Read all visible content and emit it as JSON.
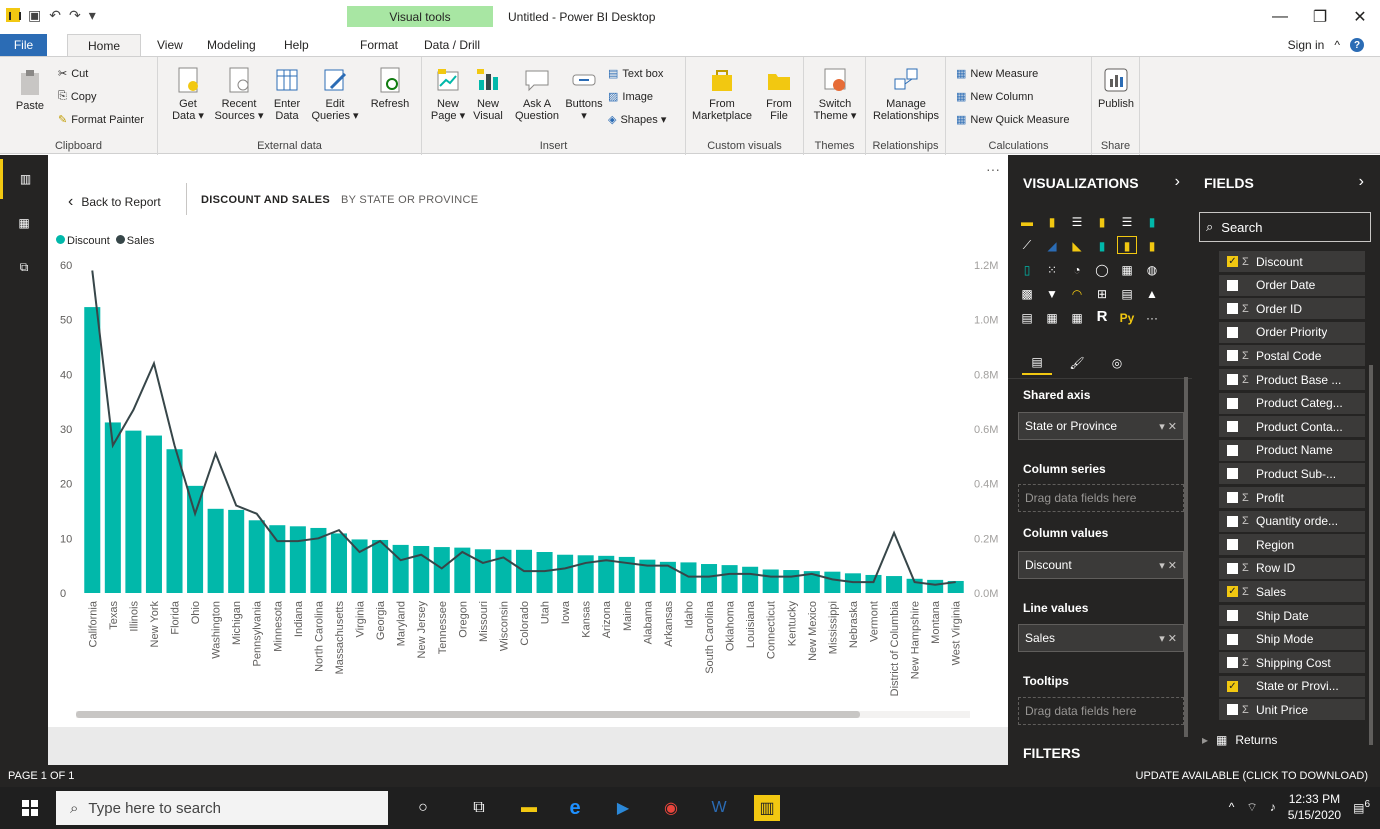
{
  "window": {
    "title": "Untitled - Power BI Desktop",
    "context_tab": "Visual tools",
    "controls": [
      "—",
      "❐",
      "✕"
    ]
  },
  "menu": {
    "file": "File",
    "tabs": [
      "Home",
      "View",
      "Modeling",
      "Help",
      "Format",
      "Data / Drill"
    ],
    "sign_in": "Sign in"
  },
  "ribbon": {
    "clipboard": {
      "label": "Clipboard",
      "paste": "Paste",
      "cut": "Cut",
      "copy": "Copy",
      "format_painter": "Format Painter"
    },
    "external_data": {
      "label": "External data",
      "get_data": "Get Data ▾",
      "recent_sources": "Recent Sources ▾",
      "enter_data": "Enter Data",
      "edit_queries": "Edit Queries ▾",
      "refresh": "Refresh"
    },
    "insert": {
      "label": "Insert",
      "new_page": "New Page ▾",
      "new_visual": "New Visual",
      "ask_question": "Ask A Question",
      "buttons": "Buttons ▾",
      "text_box": "Text box",
      "image": "Image",
      "shapes": "Shapes ▾"
    },
    "custom_visuals": {
      "label": "Custom visuals",
      "from_marketplace": "From Marketplace",
      "from_file": "From File"
    },
    "themes": {
      "label": "Themes",
      "switch_theme": "Switch Theme ▾"
    },
    "relationships": {
      "label": "Relationships",
      "manage": "Manage Relationships"
    },
    "calculations": {
      "label": "Calculations",
      "new_measure": "New Measure",
      "new_column": "New Column",
      "new_quick_measure": "New Quick Measure"
    },
    "share": {
      "label": "Share",
      "publish": "Publish"
    }
  },
  "report": {
    "back": "Back to Report",
    "crumb_main": "DISCOUNT AND SALES",
    "crumb_sub": "BY STATE OR PROVINCE",
    "more": "···",
    "legend": [
      {
        "name": "Discount",
        "color": "#01b8aa"
      },
      {
        "name": "Sales",
        "color": "#374649"
      }
    ]
  },
  "chart_data": {
    "type": "bar",
    "categories": [
      "California",
      "Texas",
      "Illinois",
      "New York",
      "Florida",
      "Ohio",
      "Washington",
      "Michigan",
      "Pennsylvania",
      "Minnesota",
      "Indiana",
      "North Carolina",
      "Massachusetts",
      "Virginia",
      "Georgia",
      "Maryland",
      "New Jersey",
      "Tennessee",
      "Oregon",
      "Missouri",
      "Wisconsin",
      "Colorado",
      "Utah",
      "Iowa",
      "Kansas",
      "Arizona",
      "Maine",
      "Alabama",
      "Arkansas",
      "Idaho",
      "South Carolina",
      "Oklahoma",
      "Louisiana",
      "Connecticut",
      "Kentucky",
      "New Mexico",
      "Mississippi",
      "Nebraska",
      "Vermont",
      "District of Columbia",
      "New Hampshire",
      "Montana",
      "West Virginia"
    ],
    "series": [
      {
        "name": "Discount",
        "type": "bar",
        "axis": "left",
        "color": "#01b8aa",
        "values": [
          52.3,
          31.2,
          29.7,
          28.8,
          26.3,
          19.6,
          15.4,
          15.2,
          13.3,
          12.4,
          12.2,
          11.9,
          10.9,
          9.8,
          9.7,
          8.8,
          8.6,
          8.4,
          8.3,
          8.0,
          7.9,
          7.9,
          7.5,
          7.0,
          6.9,
          6.8,
          6.6,
          6.1,
          5.7,
          5.6,
          5.3,
          5.1,
          4.8,
          4.3,
          4.2,
          4.0,
          3.9,
          3.6,
          3.3,
          3.1,
          2.6,
          2.4,
          2.2
        ]
      },
      {
        "name": "Sales",
        "type": "line",
        "axis": "right",
        "color": "#374649",
        "values": [
          1180000,
          540000,
          670000,
          840000,
          540000,
          290000,
          510000,
          320000,
          290000,
          190000,
          190000,
          200000,
          230000,
          150000,
          190000,
          120000,
          140000,
          90000,
          150000,
          110000,
          130000,
          80000,
          80000,
          90000,
          110000,
          120000,
          110000,
          100000,
          100000,
          60000,
          60000,
          70000,
          70000,
          60000,
          60000,
          70000,
          50000,
          40000,
          40000,
          220000,
          40000,
          30000,
          40000
        ]
      }
    ],
    "y_left": {
      "min": 0,
      "max": 60,
      "ticks": [
        0,
        10,
        20,
        30,
        40,
        50,
        60
      ]
    },
    "y_right": {
      "min": 0,
      "max": 1200000,
      "ticks": [
        "0.0M",
        "0.2M",
        "0.4M",
        "0.6M",
        "0.8M",
        "1.0M",
        "1.2M"
      ]
    },
    "legend_position": "top-left",
    "grid": false
  },
  "visualizations": {
    "title": "VISUALIZATIONS",
    "wells": [
      {
        "label": "Shared axis",
        "value": "State or Province"
      },
      {
        "label": "Column series",
        "placeholder": "Drag data fields here"
      },
      {
        "label": "Column values",
        "value": "Discount"
      },
      {
        "label": "Line values",
        "value": "Sales"
      },
      {
        "label": "Tooltips",
        "placeholder": "Drag data fields here"
      }
    ],
    "filters": "FILTERS"
  },
  "fields": {
    "title": "FIELDS",
    "search_placeholder": "Search",
    "items": [
      {
        "name": "Discount",
        "sigma": true,
        "checked": true
      },
      {
        "name": "Order Date",
        "sigma": false,
        "checked": false
      },
      {
        "name": "Order ID",
        "sigma": true,
        "checked": false
      },
      {
        "name": "Order Priority",
        "sigma": false,
        "checked": false
      },
      {
        "name": "Postal Code",
        "sigma": true,
        "checked": false
      },
      {
        "name": "Product Base ...",
        "sigma": true,
        "checked": false
      },
      {
        "name": "Product Categ...",
        "sigma": false,
        "checked": false
      },
      {
        "name": "Product Conta...",
        "sigma": false,
        "checked": false
      },
      {
        "name": "Product Name",
        "sigma": false,
        "checked": false
      },
      {
        "name": "Product Sub-...",
        "sigma": false,
        "checked": false
      },
      {
        "name": "Profit",
        "sigma": true,
        "checked": false
      },
      {
        "name": "Quantity orde...",
        "sigma": true,
        "checked": false
      },
      {
        "name": "Region",
        "sigma": false,
        "checked": false
      },
      {
        "name": "Row ID",
        "sigma": true,
        "checked": false
      },
      {
        "name": "Sales",
        "sigma": true,
        "checked": true
      },
      {
        "name": "Ship Date",
        "sigma": false,
        "checked": false
      },
      {
        "name": "Ship Mode",
        "sigma": false,
        "checked": false
      },
      {
        "name": "Shipping Cost",
        "sigma": true,
        "checked": false
      },
      {
        "name": "State or Provi...",
        "sigma": false,
        "checked": true
      },
      {
        "name": "Unit Price",
        "sigma": true,
        "checked": false
      }
    ],
    "returns": "Returns"
  },
  "status": {
    "page": "PAGE 1 OF 1",
    "update": "UPDATE AVAILABLE (CLICK TO DOWNLOAD)"
  },
  "taskbar": {
    "search_placeholder": "Type here to search",
    "time": "12:33 PM",
    "date": "5/15/2020",
    "notifications": "6"
  },
  "colors": {
    "accent": "#f2c811",
    "dark_pane": "#252423",
    "file_tab": "#2b6cb5",
    "context_tab": "#a8e6a3"
  }
}
